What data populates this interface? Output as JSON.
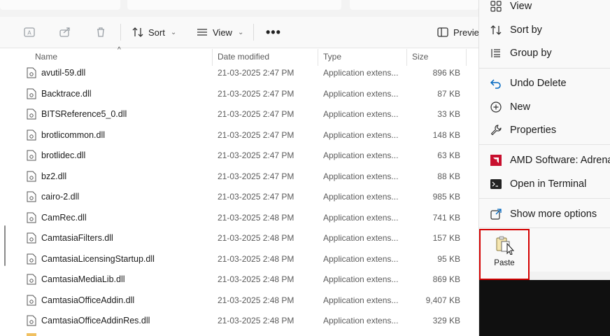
{
  "toolbar": {
    "sort_label": "Sort",
    "view_label": "View",
    "more_label": "•••",
    "preview_label": "Previe"
  },
  "columns": {
    "name": "Name",
    "date": "Date modified",
    "type": "Type",
    "size": "Size"
  },
  "files": [
    {
      "name": "avutil-59.dll",
      "date": "21-03-2025 2:47 PM",
      "type": "Application extens...",
      "size": "896 KB"
    },
    {
      "name": "Backtrace.dll",
      "date": "21-03-2025 2:47 PM",
      "type": "Application extens...",
      "size": "87 KB"
    },
    {
      "name": "BITSReference5_0.dll",
      "date": "21-03-2025 2:47 PM",
      "type": "Application extens...",
      "size": "33 KB"
    },
    {
      "name": "brotlicommon.dll",
      "date": "21-03-2025 2:47 PM",
      "type": "Application extens...",
      "size": "148 KB"
    },
    {
      "name": "brotlidec.dll",
      "date": "21-03-2025 2:47 PM",
      "type": "Application extens...",
      "size": "63 KB"
    },
    {
      "name": "bz2.dll",
      "date": "21-03-2025 2:47 PM",
      "type": "Application extens...",
      "size": "88 KB"
    },
    {
      "name": "cairo-2.dll",
      "date": "21-03-2025 2:47 PM",
      "type": "Application extens...",
      "size": "985 KB"
    },
    {
      "name": "CamRec.dll",
      "date": "21-03-2025 2:48 PM",
      "type": "Application extens...",
      "size": "741 KB"
    },
    {
      "name": "CamtasiaFilters.dll",
      "date": "21-03-2025 2:48 PM",
      "type": "Application extens...",
      "size": "157 KB"
    },
    {
      "name": "CamtasiaLicensingStartup.dll",
      "date": "21-03-2025 2:48 PM",
      "type": "Application extens...",
      "size": "95 KB"
    },
    {
      "name": "CamtasiaMediaLib.dll",
      "date": "21-03-2025 2:48 PM",
      "type": "Application extens...",
      "size": "869 KB"
    },
    {
      "name": "CamtasiaOfficeAddin.dll",
      "date": "21-03-2025 2:48 PM",
      "type": "Application extens...",
      "size": "9,407 KB"
    },
    {
      "name": "CamtasiaOfficeAddinRes.dll",
      "date": "21-03-2025 2:48 PM",
      "type": "Application extens...",
      "size": "329 KB"
    }
  ],
  "menu": {
    "view": "View",
    "sort_by": "Sort by",
    "group_by": "Group by",
    "undo_delete": "Undo Delete",
    "new": "New",
    "properties": "Properties",
    "amd": "AMD Software: Adrena",
    "terminal": "Open in Terminal",
    "more_options": "Show more options",
    "paste": "Paste"
  },
  "colors": {
    "accent": "#0067c0",
    "highlight_border": "#d40000",
    "amd_red": "#c8102e"
  }
}
